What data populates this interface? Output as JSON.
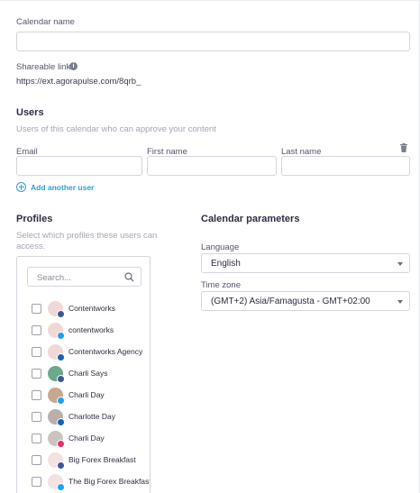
{
  "calendar": {
    "name_label": "Calendar name",
    "name_value": "",
    "shareable_label": "Shareable link",
    "shareable_url": "https://ext.agorapulse.com/8qrb_"
  },
  "users": {
    "title": "Users",
    "subtitle": "Users of this calendar who can approve your content",
    "email_label": "Email",
    "first_name_label": "First name",
    "last_name_label": "Last name",
    "add_user_label": "Add another user"
  },
  "profiles": {
    "title": "Profiles",
    "subtitle": "Select which profiles these users can access.",
    "search_placeholder": "Search...",
    "items": [
      {
        "name": "Contentworks",
        "network": "facebook"
      },
      {
        "name": "contentworks",
        "network": "twitter"
      },
      {
        "name": "Contentworks Agency",
        "network": "linkedin"
      },
      {
        "name": "Charli Says",
        "network": "facebook"
      },
      {
        "name": "Charli Day",
        "network": "twitter"
      },
      {
        "name": "Charlotte Day",
        "network": "linkedin"
      },
      {
        "name": "Charli Day",
        "network": "instagram"
      },
      {
        "name": "Big Forex Breakfast",
        "network": "facebook"
      },
      {
        "name": "The Big Forex Breakfast",
        "network": "twitter"
      }
    ]
  },
  "parameters": {
    "title": "Calendar parameters",
    "language_label": "Language",
    "language_value": "English",
    "timezone_label": "Time zone",
    "timezone_value": "(GMT+2) Asia/Famagusta - GMT+02:00"
  },
  "colors": {
    "accent": "#2e9fd4",
    "facebook": "#3b5998",
    "twitter": "#1da1f2",
    "linkedin": "#0a66c2",
    "instagram": "#e1306c"
  }
}
